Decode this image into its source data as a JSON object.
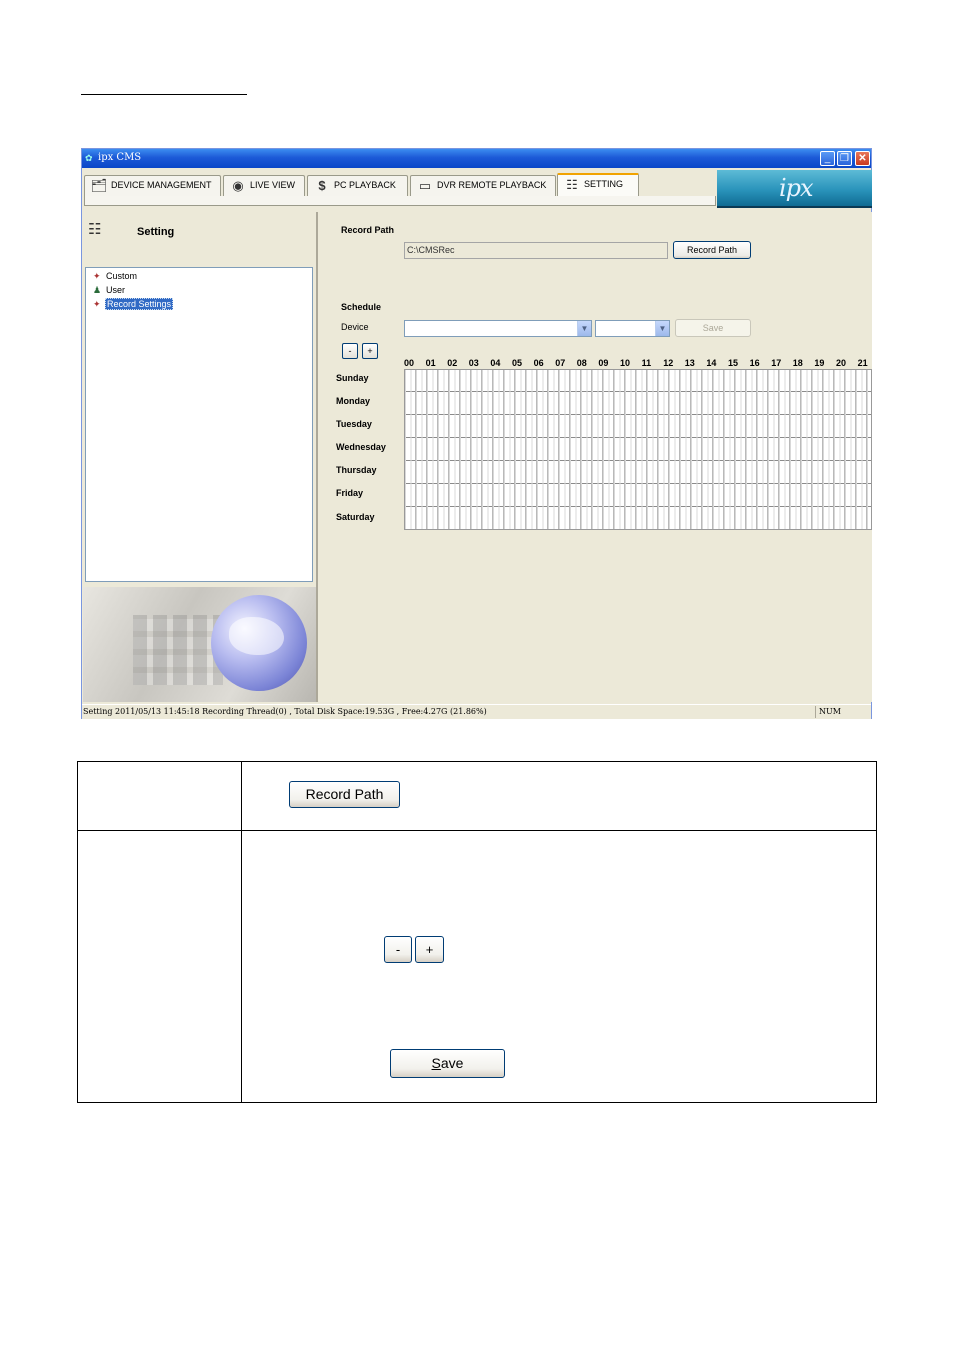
{
  "window": {
    "title": "ipx CMS",
    "controls": {
      "minimize": "_",
      "maximize": "❐",
      "close": "✕"
    }
  },
  "tabs": [
    {
      "label": "DEVICE MANAGEMENT",
      "icon": "device-management-icon"
    },
    {
      "label": "LIVE VIEW",
      "icon": "eye-icon"
    },
    {
      "label": "PC PLAYBACK",
      "icon": "dollar-icon"
    },
    {
      "label": "DVR REMOTE PLAYBACK",
      "icon": "dvr-icon"
    },
    {
      "label": "SETTING",
      "icon": "setting-icon",
      "active": true
    }
  ],
  "brand": {
    "logo_text": "ipx"
  },
  "left_panel": {
    "title": "Setting",
    "tree": [
      {
        "label": "Custom",
        "icon": "custom-icon"
      },
      {
        "label": "User",
        "icon": "user-icon"
      },
      {
        "label": "Record Settings",
        "icon": "record-settings-icon",
        "selected": true
      }
    ]
  },
  "record_path": {
    "heading": "Record Path",
    "value": "C:\\CMSRec",
    "button_label": "Record Path"
  },
  "schedule": {
    "heading": "Schedule",
    "device_label": "Device",
    "device_value": "",
    "second_value": "",
    "save_label": "Save",
    "minus_label": "-",
    "plus_label": "+",
    "hours": [
      "00",
      "01",
      "02",
      "03",
      "04",
      "05",
      "06",
      "07",
      "08",
      "09",
      "10",
      "11",
      "12",
      "13",
      "14",
      "15",
      "16",
      "17",
      "18",
      "19",
      "20",
      "21"
    ],
    "days": [
      "Sunday",
      "Monday",
      "Tuesday",
      "Wednesday",
      "Thursday",
      "Friday",
      "Saturday"
    ]
  },
  "statusbar": {
    "text": "Setting  2011/05/13 11:45:18   Recording Thread(0) , Total Disk Space:19.53G , Free:4.27G (21.86%)",
    "num": "NUM"
  },
  "doc_table": {
    "record_path_button": "Record Path",
    "minus_button": "-",
    "plus_button": "+",
    "save_button_underlined": "S",
    "save_button_rest": "ave"
  },
  "colors": {
    "titlebar": "#0a46c8",
    "active_tab_accent": "#f1a300",
    "selection": "#316ac5",
    "brand": "#2a94bb"
  }
}
